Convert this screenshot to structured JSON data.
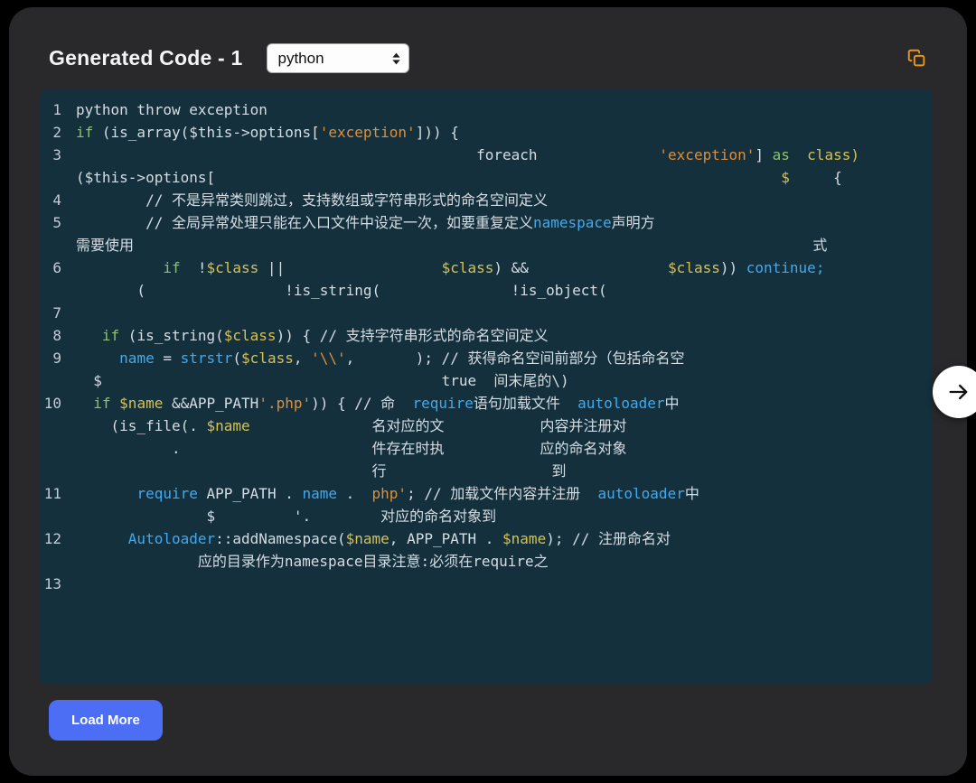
{
  "header": {
    "title": "Generated Code - 1",
    "language_selected": "python"
  },
  "colors": {
    "copy_icon": "#e8941a",
    "load_more_bg": "#4c6ef5",
    "code_bg": "#14303d"
  },
  "code": {
    "rows": [
      {
        "num": "1",
        "segs": [
          [
            "python throw exception",
            "p"
          ]
        ]
      },
      {
        "num": "2",
        "segs": [
          [
            "if",
            "g"
          ],
          [
            " (is_array($this->options[",
            "p"
          ],
          [
            "'exception'",
            "o"
          ],
          [
            "])) {",
            "p"
          ]
        ]
      },
      {
        "num": "3",
        "segs": [
          [
            "                                              foreach              ",
            "p"
          ],
          [
            "'exception'",
            "o"
          ],
          [
            "] ",
            "p"
          ],
          [
            "as",
            "g"
          ],
          [
            "  ",
            "p"
          ],
          [
            "class)",
            "y"
          ]
        ]
      },
      {
        "num": "",
        "segs": [
          [
            "($this->options[",
            "p"
          ],
          [
            "                                                                 ",
            "p"
          ],
          [
            "$",
            "y"
          ],
          [
            "     {",
            "p"
          ]
        ]
      },
      {
        "num": "4",
        "segs": [
          [
            "        // 不是异常类则跳过，支持数组或字符串形式的命名空间定义",
            "p"
          ]
        ]
      },
      {
        "num": "5",
        "segs": [
          [
            "        // 全局异常处理只能在入口文件中设定一次，如要重复定义",
            "p"
          ],
          [
            "namespace",
            "b"
          ],
          [
            "声明方",
            "p"
          ]
        ]
      },
      {
        "num": "",
        "segs": [
          [
            "需要使用",
            "p"
          ],
          [
            "                                                                              式",
            "p"
          ]
        ]
      },
      {
        "num": "6",
        "segs": [
          [
            "          ",
            "p"
          ],
          [
            "if",
            "g"
          ],
          [
            "  !",
            "p"
          ],
          [
            "$class",
            "y"
          ],
          [
            " ||                  ",
            "p"
          ],
          [
            "$class",
            "y"
          ],
          [
            ") &&                ",
            "p"
          ],
          [
            "$class",
            "y"
          ],
          [
            ")) ",
            "p"
          ],
          [
            "continue;",
            "b"
          ]
        ]
      },
      {
        "num": "",
        "segs": [
          [
            "       (                !is_string(               !is_object(",
            "p"
          ]
        ]
      },
      {
        "num": "7",
        "segs": []
      },
      {
        "num": "8",
        "segs": [
          [
            "   ",
            "p"
          ],
          [
            "if",
            "g"
          ],
          [
            " (is_string(",
            "p"
          ],
          [
            "$class",
            "y"
          ],
          [
            ")) { // 支持字符串形式的命名空间定义",
            "p"
          ]
        ]
      },
      {
        "num": "9",
        "segs": [
          [
            "     ",
            "p"
          ],
          [
            "name",
            "b"
          ],
          [
            " = ",
            "p"
          ],
          [
            "strstr",
            "b"
          ],
          [
            "(",
            "p"
          ],
          [
            "$class",
            "y"
          ],
          [
            ", ",
            "p"
          ],
          [
            "'\\\\'",
            "o"
          ],
          [
            ",       ); // 获得命名空间前部分（包括命名空",
            "p"
          ]
        ]
      },
      {
        "num": "",
        "segs": [
          [
            "  $",
            "p"
          ],
          [
            "                                       ",
            "p"
          ],
          [
            "true",
            "p"
          ],
          [
            "  间末尾的\\)",
            "p"
          ]
        ]
      },
      {
        "num": "10",
        "segs": [
          [
            "  ",
            "p"
          ],
          [
            "if",
            "g"
          ],
          [
            " ",
            "p"
          ],
          [
            "$name",
            "y"
          ],
          [
            " &&APP_PATH",
            "p"
          ],
          [
            "'.php'",
            "o"
          ],
          [
            ")) { // 命  ",
            "p"
          ],
          [
            "require",
            "b"
          ],
          [
            "语句加载文件  ",
            "p"
          ],
          [
            "autoloader",
            "b"
          ],
          [
            "中",
            "p"
          ]
        ]
      },
      {
        "num": "",
        "segs": [
          [
            "    (is_file(. ",
            "p"
          ],
          [
            "$name",
            "y"
          ],
          [
            "              名对应的文           内容并注册对",
            "p"
          ]
        ]
      },
      {
        "num": "",
        "segs": [
          [
            "           .                      件存在时执           应的命名对象",
            "p"
          ]
        ]
      },
      {
        "num": "",
        "segs": [
          [
            "                                  行                   到",
            "p"
          ]
        ]
      },
      {
        "num": "11",
        "segs": [
          [
            "       ",
            "p"
          ],
          [
            "require",
            "b"
          ],
          [
            " APP_PATH . ",
            "p"
          ],
          [
            "name",
            "b"
          ],
          [
            " .  ",
            "p"
          ],
          [
            "php'",
            "o"
          ],
          [
            "; // 加载文件内容并注册  ",
            "p"
          ],
          [
            "autoloader",
            "b"
          ],
          [
            "中",
            "p"
          ]
        ]
      },
      {
        "num": "",
        "segs": [
          [
            "               $         '.        对应的命名对象到",
            "p"
          ]
        ]
      },
      {
        "num": "12",
        "segs": [
          [
            "      ",
            "p"
          ],
          [
            "Autoloader",
            "b"
          ],
          [
            "::addNamespace(",
            "p"
          ],
          [
            "$name",
            "y"
          ],
          [
            ", APP_PATH . ",
            "p"
          ],
          [
            "$name",
            "y"
          ],
          [
            "); // 注册命名对",
            "p"
          ]
        ]
      },
      {
        "num": "",
        "segs": [
          [
            "              应的目录作为namespace目录注意:必须在require之",
            "p"
          ]
        ]
      },
      {
        "num": "13",
        "segs": []
      }
    ]
  },
  "actions": {
    "load_more": "Load More"
  }
}
